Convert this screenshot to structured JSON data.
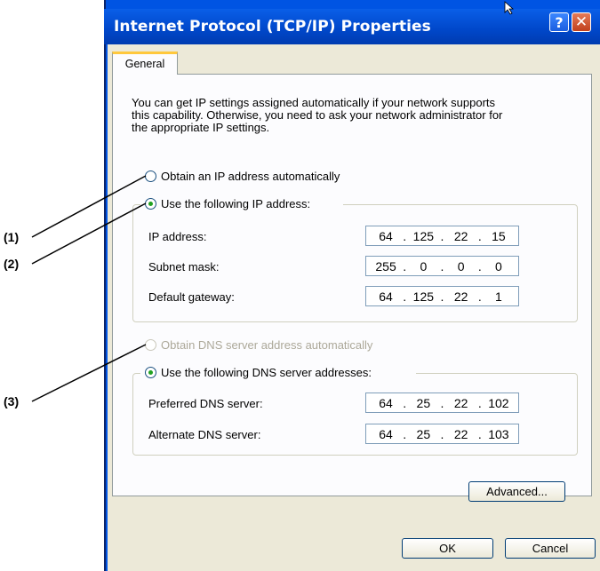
{
  "window": {
    "title": "Internet Protocol (TCP/IP) Properties",
    "help_label": "?",
    "close_label": "✕"
  },
  "tabs": [
    {
      "label": "General"
    }
  ],
  "description": [
    "You can get IP settings assigned automatically if your network supports",
    "this capability. Otherwise, you need to ask your network administrator for",
    "the appropriate IP settings."
  ],
  "ip": {
    "auto_label": "Obtain an IP address automatically",
    "manual_label": "Use the following IP address:",
    "selected": "manual",
    "fields": [
      {
        "label": "IP address:",
        "octets": [
          "64",
          "125",
          "22",
          "15"
        ]
      },
      {
        "label": "Subnet mask:",
        "octets": [
          "255",
          "0",
          "0",
          "0"
        ]
      },
      {
        "label": "Default gateway:",
        "octets": [
          "64",
          "125",
          "22",
          "1"
        ]
      }
    ]
  },
  "dns": {
    "auto_label": "Obtain DNS server address automatically",
    "auto_disabled": true,
    "manual_label": "Use the following DNS server addresses:",
    "selected": "manual",
    "fields": [
      {
        "label": "Preferred DNS server:",
        "octets": [
          "64",
          "25",
          "22",
          "102"
        ]
      },
      {
        "label": "Alternate DNS server:",
        "octets": [
          "64",
          "25",
          "22",
          "103"
        ]
      }
    ]
  },
  "buttons": {
    "advanced": "Advanced...",
    "ok": "OK",
    "cancel": "Cancel"
  },
  "callouts": [
    "(1)",
    "(2)",
    "(3)"
  ],
  "colors": {
    "titlebar": "#0054e3",
    "face": "#ece9d8",
    "tab_accent": "#ffc83c",
    "radio_dot": "#21a121"
  }
}
